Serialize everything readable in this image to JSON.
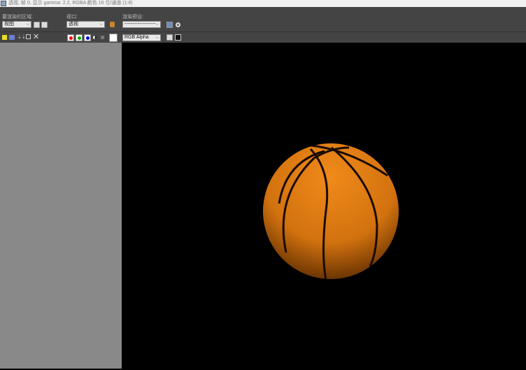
{
  "title": "透视, 帧 0, 显示 gamma: 2.2, RGBA 颜色 16 位/通道 (1:8)",
  "area_to_render": {
    "label": "要渲染的区域:",
    "value": "视图"
  },
  "viewport": {
    "label": "视口:",
    "value": "透视"
  },
  "render_preset": {
    "label": "渲染预设:",
    "value": "-------------------"
  },
  "channel": {
    "value": "RGB Alpha"
  },
  "colors": {
    "ball": "#d87a14",
    "seam": "#1a0a00",
    "panel": "#898989"
  }
}
